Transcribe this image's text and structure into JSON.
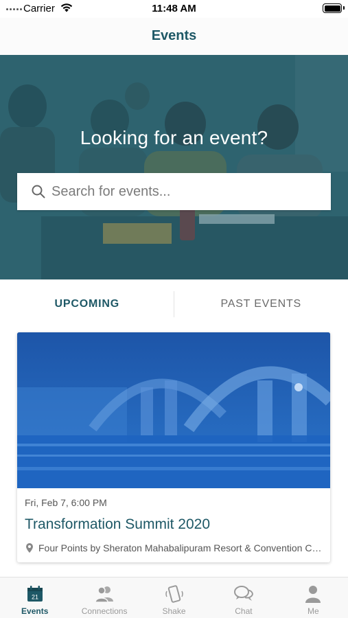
{
  "status_bar": {
    "carrier": "Carrier",
    "time": "11:48 AM",
    "battery_level": 1.0
  },
  "nav": {
    "title": "Events"
  },
  "hero": {
    "title": "Looking for an event?",
    "search_placeholder": "Search for events...",
    "search_icon": "search-icon"
  },
  "tabs": [
    {
      "label": "UPCOMING",
      "active": true
    },
    {
      "label": "PAST EVENTS",
      "active": false
    }
  ],
  "events": [
    {
      "date": "Fri, Feb 7, 6:00 PM",
      "title": "Transformation Summit 2020",
      "location": "Four Points by Sheraton Mahabalipuram Resort & Convention Center",
      "location_icon": "map-pin-icon"
    }
  ],
  "tab_bar": {
    "items": [
      {
        "label": "Events",
        "icon": "calendar-icon",
        "icon_text": "21",
        "active": true
      },
      {
        "label": "Connections",
        "icon": "people-icon",
        "active": false
      },
      {
        "label": "Shake",
        "icon": "shake-phone-icon",
        "active": false
      },
      {
        "label": "Chat",
        "icon": "chat-bubbles-icon",
        "active": false
      },
      {
        "label": "Me",
        "icon": "person-icon",
        "active": false
      }
    ]
  },
  "colors": {
    "brand": "#1e5866",
    "inactive": "#9a9a9a",
    "hero_overlay": "#2d5f6d",
    "card_image": "#1f5bb3"
  }
}
